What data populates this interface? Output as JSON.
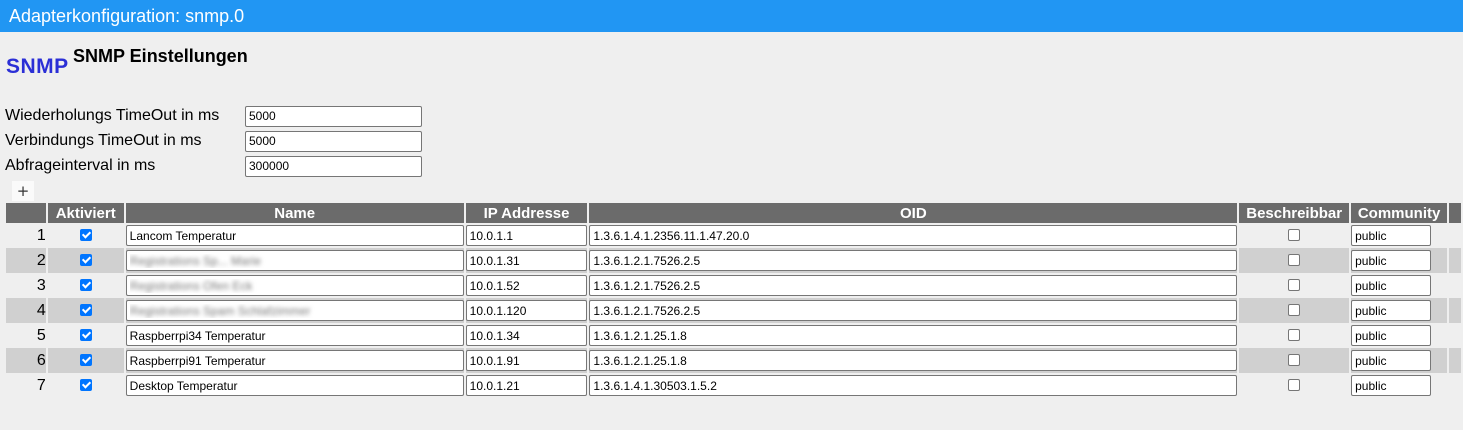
{
  "window": {
    "title": "Adapterkonfiguration: snmp.0"
  },
  "header": {
    "logo_text": "SNMP",
    "title": "SNMP Einstellungen"
  },
  "settings": {
    "retry_timeout": {
      "label": "Wiederholungs TimeOut in ms",
      "value": "5000"
    },
    "connect_timeout": {
      "label": "Verbindungs TimeOut in ms",
      "value": "5000"
    },
    "poll_interval": {
      "label": "Abfrageinterval in ms",
      "value": "300000"
    }
  },
  "table": {
    "add_label": "+",
    "columns": [
      "",
      "Aktiviert",
      "Name",
      "IP Addresse",
      "OID",
      "Beschreibbar",
      "Community"
    ],
    "rows": [
      {
        "num": "1",
        "active": true,
        "name": "Lancom Temperatur",
        "ip": "10.0.1.1",
        "oid": "1.3.6.1.4.1.2356.11.1.47.20.0",
        "writable": false,
        "community": "public"
      },
      {
        "num": "2",
        "active": true,
        "name": "Registrations Sp... Marie",
        "ip": "10.0.1.31",
        "oid": "1.3.6.1.2.1.7526.2.5",
        "writable": false,
        "community": "public"
      },
      {
        "num": "3",
        "active": true,
        "name": "Registrations Ofen Eck",
        "ip": "10.0.1.52",
        "oid": "1.3.6.1.2.1.7526.2.5",
        "writable": false,
        "community": "public"
      },
      {
        "num": "4",
        "active": true,
        "name": "Registrations Spam Schlafzimmer",
        "ip": "10.0.1.120",
        "oid": "1.3.6.1.2.1.7526.2.5",
        "writable": false,
        "community": "public"
      },
      {
        "num": "5",
        "active": true,
        "name": "Raspberrpi34 Temperatur",
        "ip": "10.0.1.34",
        "oid": "1.3.6.1.2.1.25.1.8",
        "writable": false,
        "community": "public"
      },
      {
        "num": "6",
        "active": true,
        "name": "Raspberrpi91 Temperatur",
        "ip": "10.0.1.91",
        "oid": "1.3.6.1.2.1.25.1.8",
        "writable": false,
        "community": "public"
      },
      {
        "num": "7",
        "active": true,
        "name": "Desktop Temperatur",
        "ip": "10.0.1.21",
        "oid": "1.3.6.1.4.1.30503.1.5.2",
        "writable": false,
        "community": "public"
      }
    ]
  },
  "colors": {
    "titlebar": "#2196f3",
    "logo": "#2b2fd6",
    "header_bg": "#6b6b6b",
    "row_alt": "#d0d0d0",
    "checkbox": "#0075ff"
  }
}
